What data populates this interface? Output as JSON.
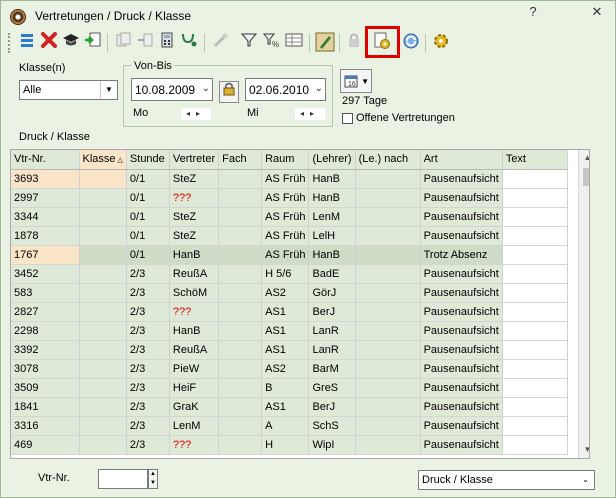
{
  "window": {
    "title": "Vertretungen / Druck / Klasse",
    "help_label": "?",
    "close_label": "✕"
  },
  "toolbar": {
    "buttons": [
      "list",
      "delete",
      "graduate",
      "import",
      "disabled-copy",
      "disabled-export",
      "calculator",
      "stethoscope",
      "disabled-tool",
      "filter",
      "percent-filter",
      "grid-view",
      "edit",
      "disabled-lock",
      "settings-gear-doc",
      "refresh",
      "gear"
    ]
  },
  "filters": {
    "klasse_label": "Klasse(n)",
    "klasse_value": "Alle",
    "vonbis_label": "Von-Bis",
    "von_date": "10.08.2009",
    "von_day": "Mo",
    "bis_date": "02.06.2010",
    "bis_day": "Mi",
    "days_text": "297 Tage",
    "offene_label": "Offene Vertretungen"
  },
  "section_title": "Druck / Klasse",
  "table": {
    "headers": [
      "Vtr-Nr.",
      "Klasse",
      "Stunde",
      "Vertreter",
      "Fach",
      "Raum",
      "(Lehrer)",
      "(Le.) nach",
      "Art",
      "Text"
    ],
    "rows": [
      [
        "3693",
        "",
        "0/1",
        "SteZ",
        "",
        "AS Früh",
        "HanB",
        "",
        "Pausenaufsicht",
        ""
      ],
      [
        "2997",
        "",
        "0/1",
        "???",
        "",
        "AS Früh",
        "HanB",
        "",
        "Pausenaufsicht",
        ""
      ],
      [
        "3344",
        "",
        "0/1",
        "SteZ",
        "",
        "AS Früh",
        "LenM",
        "",
        "Pausenaufsicht",
        ""
      ],
      [
        "1878",
        "",
        "0/1",
        "SteZ",
        "",
        "AS Früh",
        "LelH",
        "",
        "Pausenaufsicht",
        ""
      ],
      [
        "1767",
        "",
        "0/1",
        "HanB",
        "",
        "AS Früh",
        "HanB",
        "",
        "Trotz Absenz",
        ""
      ],
      [
        "3452",
        "",
        "2/3",
        "ReußA",
        "",
        "H 5/6",
        "BadE",
        "",
        "Pausenaufsicht",
        ""
      ],
      [
        "583",
        "",
        "2/3",
        "SchöM",
        "",
        "AS2",
        "GörJ",
        "",
        "Pausenaufsicht",
        ""
      ],
      [
        "2827",
        "",
        "2/3",
        "???",
        "",
        "AS1",
        "BerJ",
        "",
        "Pausenaufsicht",
        ""
      ],
      [
        "2298",
        "",
        "2/3",
        "HanB",
        "",
        "AS1",
        "LanR",
        "",
        "Pausenaufsicht",
        ""
      ],
      [
        "3392",
        "",
        "2/3",
        "ReußA",
        "",
        "AS1",
        "LanR",
        "",
        "Pausenaufsicht",
        ""
      ],
      [
        "3078",
        "",
        "2/3",
        "PieW",
        "",
        "AS2",
        "BarM",
        "",
        "Pausenaufsicht",
        ""
      ],
      [
        "3509",
        "",
        "2/3",
        "HeiF",
        "",
        "B",
        "GreS",
        "",
        "Pausenaufsicht",
        ""
      ],
      [
        "1841",
        "",
        "2/3",
        "GraK",
        "",
        "AS1",
        "BerJ",
        "",
        "Pausenaufsicht",
        ""
      ],
      [
        "3316",
        "",
        "2/3",
        "LenM",
        "",
        "A",
        "SchS",
        "",
        "Pausenaufsicht",
        ""
      ],
      [
        "469",
        "",
        "2/3",
        "???",
        "",
        "H",
        "WipI",
        "",
        "Pausenaufsicht",
        ""
      ]
    ]
  },
  "bottom": {
    "vtr_label": "Vtr-Nr.",
    "vtr_value": "",
    "format_value": "Druck / Klasse"
  }
}
